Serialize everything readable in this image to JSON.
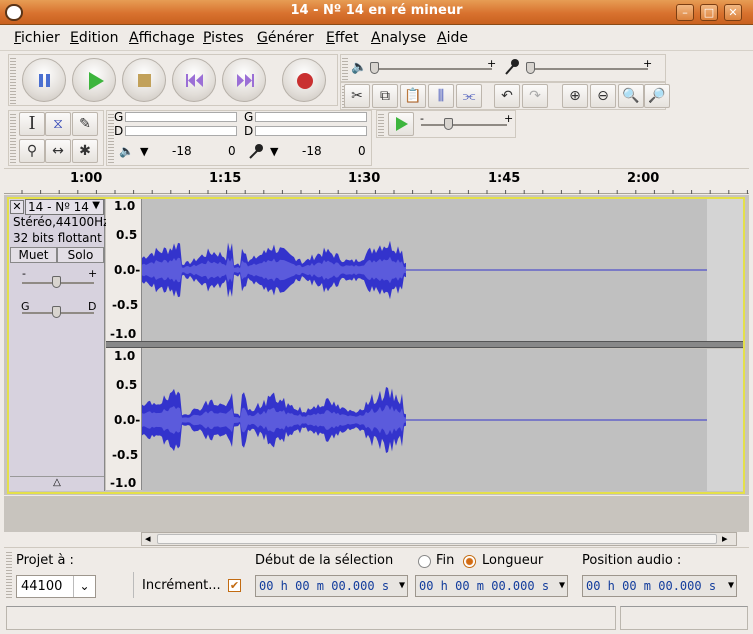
{
  "window": {
    "title": "14 - Nº 14 en ré mineur"
  },
  "menu": [
    "Fichier",
    "Edition",
    "Affichage",
    "Pistes",
    "Générer",
    "Effet",
    "Analyse",
    "Aide"
  ],
  "meter": {
    "labels": [
      "G",
      "D",
      "G",
      "D"
    ],
    "scale": [
      "-18",
      "0",
      "-18",
      "0"
    ]
  },
  "timeline": {
    "ticks": [
      "1:00",
      "1:15",
      "1:30",
      "1:45",
      "2:00"
    ]
  },
  "track": {
    "name": "14 - Nº 14",
    "format": "Stéréo,44100Hz",
    "bits": "32 bits flottant",
    "mute": "Muet",
    "solo": "Solo",
    "gain_left": "-",
    "gain_right": "+",
    "pan_left": "G",
    "pan_right": "D",
    "y_ticks": [
      "1.0",
      "0.5",
      "0.0-",
      "-0.5",
      "-1.0"
    ]
  },
  "bottom": {
    "project_label": "Projet à :",
    "project_rate": "44100",
    "snap_label": "Incrément...",
    "sel_start_label": "Début de la sélection",
    "end_option": "Fin",
    "length_option": "Longueur",
    "audio_pos_label": "Position audio :",
    "time1": "00 h 00 m 00.000 s",
    "time2": "00 h 00 m 00.000 s",
    "time3": "00 h 00 m 00.000 s"
  },
  "colors": {
    "wave": "#3333cc",
    "wave_bg": "#c0c0c0",
    "title_accent": "#d8722f"
  }
}
